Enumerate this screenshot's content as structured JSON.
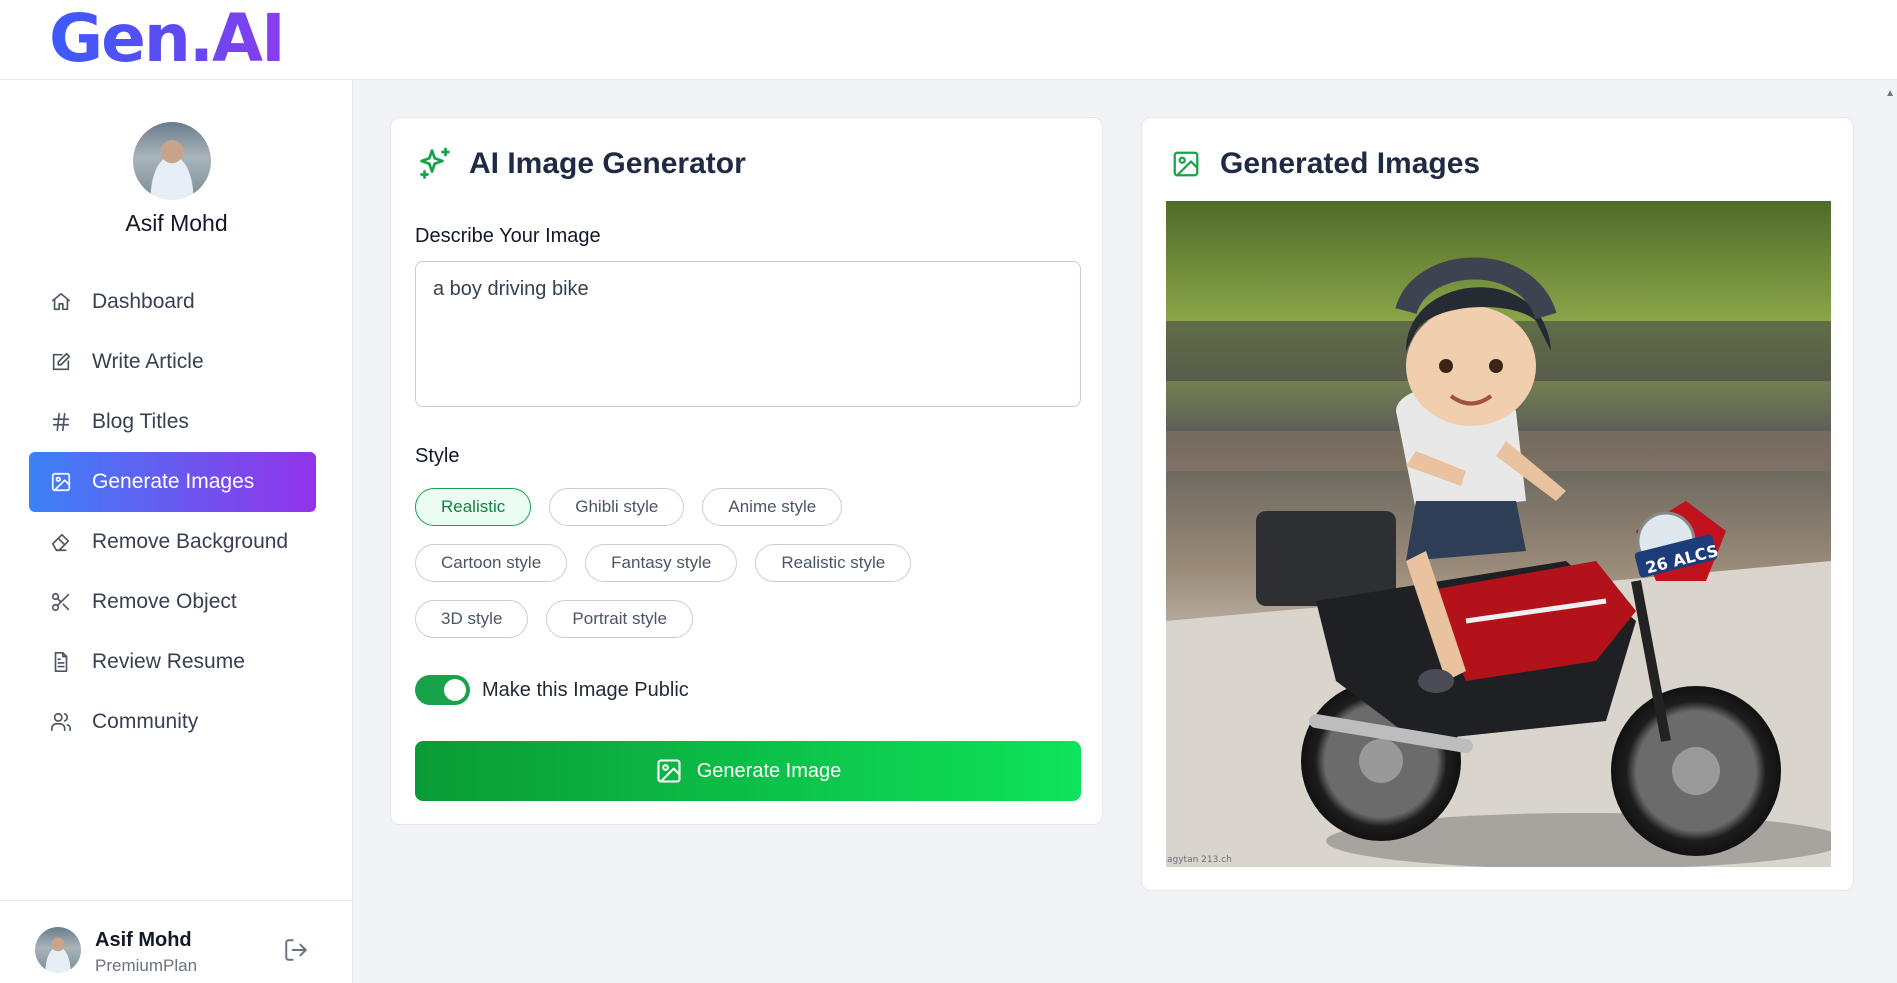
{
  "app": {
    "logo": "Gen.AI"
  },
  "sidebar": {
    "user_name": "Asif Mohd",
    "items": [
      {
        "label": "Dashboard",
        "icon": "home-icon"
      },
      {
        "label": "Write Article",
        "icon": "edit-icon"
      },
      {
        "label": "Blog Titles",
        "icon": "hash-icon"
      },
      {
        "label": "Generate Images",
        "icon": "image-icon",
        "active": true
      },
      {
        "label": "Remove Background",
        "icon": "eraser-icon"
      },
      {
        "label": "Remove Object",
        "icon": "scissors-icon"
      },
      {
        "label": "Review Resume",
        "icon": "file-text-icon"
      },
      {
        "label": "Community",
        "icon": "users-icon"
      }
    ],
    "footer": {
      "name": "Asif Mohd",
      "plan": "PremiumPlan"
    }
  },
  "generator": {
    "title": "AI Image Generator",
    "describe_label": "Describe Your Image",
    "prompt_value": "a boy driving bike",
    "style_label": "Style",
    "styles": [
      [
        "Realistic",
        "Ghibli style",
        "Anime style"
      ],
      [
        "Cartoon style",
        "Fantasy style",
        "Realistic style"
      ],
      [
        "3D style",
        "Portrait style"
      ]
    ],
    "selected_style": "Realistic",
    "public_toggle_label": "Make this Image Public",
    "public_toggle_on": true,
    "generate_button": "Generate Image"
  },
  "results": {
    "title": "Generated Images",
    "image_watermark": "agytan 213.ch",
    "plate_text": "26 ALCS"
  },
  "colors": {
    "accent_green": "#16a34a",
    "active_nav_start": "#3b82f6",
    "active_nav_end": "#9333ea",
    "logo_start": "#3b5bfd",
    "logo_end": "#8b3cf0"
  }
}
